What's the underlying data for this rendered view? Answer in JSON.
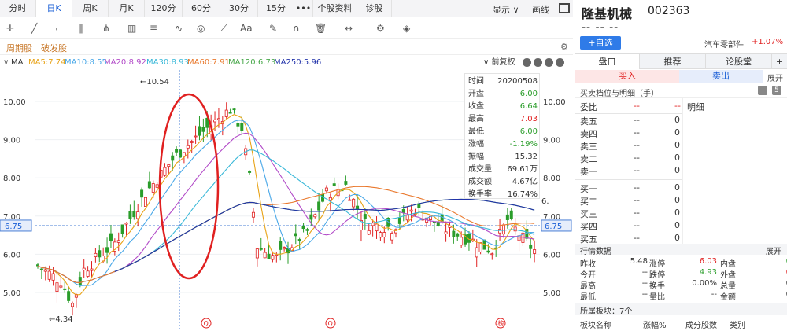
{
  "period_tabs": [
    "分时",
    "日K",
    "周K",
    "月K",
    "120分",
    "60分",
    "30分",
    "15分",
    "•••",
    "个股资料",
    "诊股"
  ],
  "active_tab": "日K",
  "display_label": "显示",
  "draw_label": "画线",
  "filters": [
    "周期股",
    "破发股"
  ],
  "ma": {
    "name": "MA",
    "items": [
      {
        "label": "MA5:7.74",
        "color": "#e8a317"
      },
      {
        "label": "MA10:8.55",
        "color": "#4aa8e8"
      },
      {
        "label": "MA20:8.92",
        "color": "#b24bc8"
      },
      {
        "label": "MA30:8.93",
        "color": "#39b8d8"
      },
      {
        "label": "MA60:7.91",
        "color": "#e9782c"
      },
      {
        "label": "MA120:6.73",
        "color": "#49a84b"
      },
      {
        "label": "MA250:5.96",
        "color": "#2233aa"
      }
    ],
    "adjust_label": "前复权"
  },
  "axis": {
    "left_ticks": [
      "10.00",
      "9.00",
      "8.00",
      "7.00",
      "6.00",
      "5.00"
    ],
    "right_ticks": [
      "10.00",
      "9.00",
      "8.00",
      "7.00",
      "6.00",
      "5.00"
    ],
    "current_price": "6.75",
    "high_label": "←10.54",
    "low_label": "←4.34",
    "right_partial": "6."
  },
  "infobox": {
    "rows": [
      {
        "k": "时间",
        "v": "20200508",
        "c": "#333"
      },
      {
        "k": "开盘",
        "v": "6.00",
        "c": "#2a9d2a"
      },
      {
        "k": "收盘",
        "v": "6.64",
        "c": "#2a9d2a"
      },
      {
        "k": "最高",
        "v": "7.03",
        "c": "#e02020"
      },
      {
        "k": "最低",
        "v": "6.00",
        "c": "#2a9d2a"
      },
      {
        "k": "涨幅",
        "v": "-1.19%",
        "c": "#2a9d2a"
      },
      {
        "k": "振幅",
        "v": "15.32",
        "c": "#333"
      },
      {
        "k": "成交量",
        "v": "69.61万",
        "c": "#333"
      },
      {
        "k": "成交额",
        "v": "4.67亿",
        "c": "#333"
      },
      {
        "k": "换手率",
        "v": "16.74%",
        "c": "#333"
      }
    ]
  },
  "stock": {
    "name": "隆基机械",
    "code": "002363",
    "price_placeholder": "-- -- --",
    "add_button": "+自选",
    "sector": "汽车零部件",
    "sector_change": "+1.07%"
  },
  "right_tabs": [
    "盘口",
    "推荐",
    "论股堂",
    "+"
  ],
  "buy_label": "买入",
  "sell_label": "卖出",
  "expand_label": "展开",
  "orderbook_title": "买卖档位与明细（手）",
  "webi": {
    "label": "委比",
    "v1": "--",
    "v2": "--"
  },
  "detail_label": "明细",
  "sells": [
    {
      "label": "卖五",
      "price": "--",
      "vol": "0"
    },
    {
      "label": "卖四",
      "price": "--",
      "vol": "0"
    },
    {
      "label": "卖三",
      "price": "--",
      "vol": "0"
    },
    {
      "label": "卖二",
      "price": "--",
      "vol": "0"
    },
    {
      "label": "卖一",
      "price": "--",
      "vol": "0"
    }
  ],
  "buys": [
    {
      "label": "买一",
      "price": "--",
      "vol": "0"
    },
    {
      "label": "买二",
      "price": "--",
      "vol": "0"
    },
    {
      "label": "买三",
      "price": "--",
      "vol": "0"
    },
    {
      "label": "买四",
      "price": "--",
      "vol": "0"
    },
    {
      "label": "买五",
      "price": "--",
      "vol": "0"
    }
  ],
  "market": {
    "title": "行情数据",
    "expand": "展开",
    "rows": [
      [
        {
          "k": "昨收",
          "v": "5.48",
          "c": "#333"
        },
        {
          "k": "涨停",
          "v": "6.03",
          "c": "#e02020"
        },
        {
          "k": "内盘",
          "v": "0",
          "c": "#2a9d2a"
        }
      ],
      [
        {
          "k": "今开",
          "v": "--",
          "c": "#333"
        },
        {
          "k": "跌停",
          "v": "4.93",
          "c": "#2a9d2a"
        },
        {
          "k": "外盘",
          "v": "0",
          "c": "#e02020"
        }
      ],
      [
        {
          "k": "最高",
          "v": "--",
          "c": "#333"
        },
        {
          "k": "换手",
          "v": "0.00%",
          "c": "#333"
        },
        {
          "k": "总量",
          "v": "0",
          "c": "#333"
        }
      ],
      [
        {
          "k": "最低",
          "v": "--",
          "c": "#333"
        },
        {
          "k": "量比",
          "v": "--",
          "c": "#333"
        },
        {
          "k": "金额",
          "v": "0",
          "c": "#333"
        }
      ]
    ]
  },
  "sector_block": {
    "title": "所属板块：7个",
    "cols": [
      "板块名称",
      "涨幅%",
      "成分股数",
      "类别"
    ]
  },
  "markers": [
    "Q",
    "Q",
    "榜"
  ],
  "colors": {
    "up": "#e02020",
    "down": "#2a9d2a",
    "accent": "#1a5fd6",
    "circle": "#e02020",
    "buy_bg": "#fde6e6",
    "sell_bg": "#e6edfb"
  }
}
